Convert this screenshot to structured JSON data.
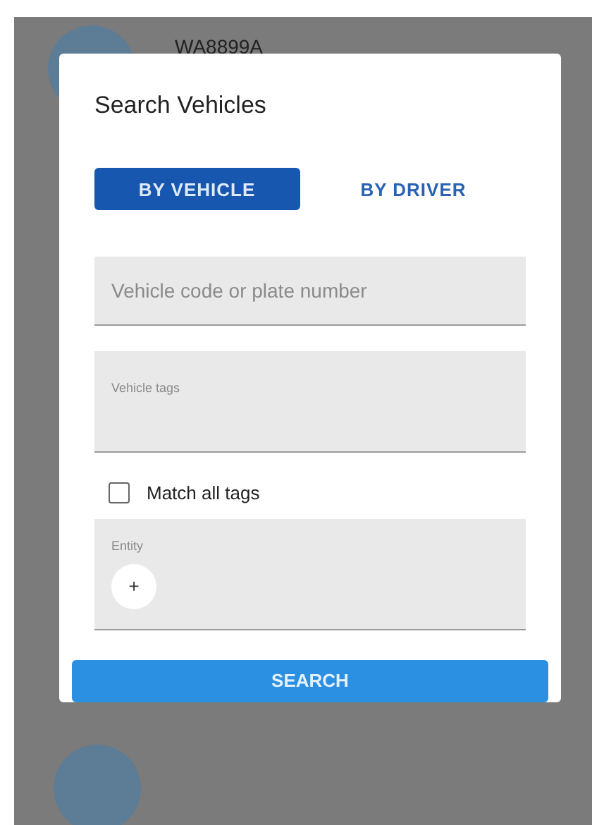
{
  "background": {
    "vehicle_code": "WA8899A"
  },
  "dialog": {
    "title": "Search Vehicles",
    "tabs": [
      {
        "label": "BY VEHICLE",
        "selected": true
      },
      {
        "label": "BY DRIVER",
        "selected": false
      }
    ],
    "vehicle_field": {
      "placeholder": "Vehicle code or plate number"
    },
    "tags_field": {
      "label": "Vehicle tags"
    },
    "match_all": {
      "label": "Match all tags",
      "checked": false
    },
    "entity_field": {
      "label": "Entity",
      "add_button": "+"
    },
    "search_button": "SEARCH"
  }
}
